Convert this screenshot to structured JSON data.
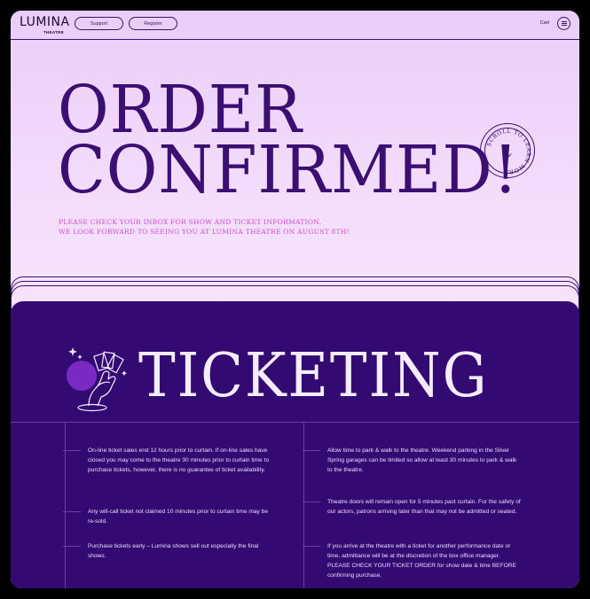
{
  "nav": {
    "logo_main": "LUMINA",
    "logo_sub": "THEATRE",
    "support_label": "Support",
    "register_label": "Register",
    "cart_label": "Cart",
    "menu_icon": "hamburger-icon"
  },
  "hero": {
    "headline_line1": "ORDER",
    "headline_line2": "CONFIRMED!",
    "sub_line1": "Please check your inbox for show and ticket information.",
    "sub_line2": "We look forward to seeing you at Lumina Theatre on August 8th!",
    "badge_text": "SCROLL TO LEARN MORE",
    "badge_icon": "arrow-down-icon"
  },
  "ticketing": {
    "title": "TICKETING",
    "illustration_icon": "hand-holding-cards-icon",
    "left_items": [
      "On-line ticket sales end 12 hours prior to curtain. If on-line sales have closed you may come to the theatre 30 minutes prior to curtain time to purchase tickets, however, there is no guarantee of ticket availability.",
      "Any will-call ticket not claimed 10 minutes prior to curtain time may be re-sold.",
      "Purchase tickets early – Lumina shows sell out especially the final shows."
    ],
    "right_items": [
      "Allow time to park & walk to the theatre. Weekend parking in the Silver Spring garages can be limited so allow at least 30 minutes to park & walk to the theatre.",
      "Theatre doors will remain open for 5 minutes past curtain. For the safety of our actors, patrons arriving later than that may not be admitted or seated.",
      "If you arrive at the theatre with a ticket for another performance date or time, admittance will be at the discretion of the box office manager. PLEASE CHECK YOUR TICKET ORDER for show date & time BEFORE confirming purchase."
    ]
  },
  "colors": {
    "hero_bg": "#efd6fa",
    "ink": "#3b0f72",
    "accent_pink": "#d24ad6",
    "ticketing_bg": "#330a72"
  }
}
